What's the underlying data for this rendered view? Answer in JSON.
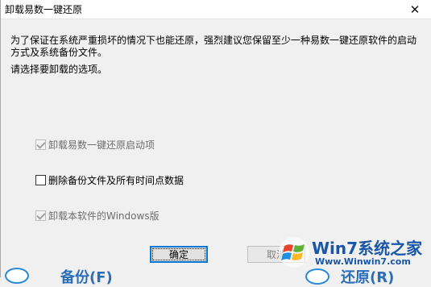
{
  "window": {
    "title": "卸载易数一键还原",
    "close_glyph": "✕"
  },
  "body": {
    "notice": "为了保证在系统严重损坏的情况下也能还原，强烈建议您保留至少一种易数一键还原软件的启动方式及系统备份文件。",
    "prompt": "请选择要卸载的选项。"
  },
  "options": [
    {
      "label": "卸载易数一键还原启动项",
      "checked": true,
      "enabled": false
    },
    {
      "label": "删除备份文件及所有时间点数据",
      "checked": false,
      "enabled": true
    },
    {
      "label": "卸载本软件的Windows版",
      "checked": true,
      "enabled": false
    }
  ],
  "buttons": {
    "ok": "确定",
    "cancel": "取消"
  },
  "watermark": {
    "title": "Win7系统之家",
    "url": "Www.Winwin7.com",
    "logo_icon": "windows-logo-icon"
  },
  "background": {
    "left_text": "备份(F)",
    "right_text": "还原(R)"
  }
}
